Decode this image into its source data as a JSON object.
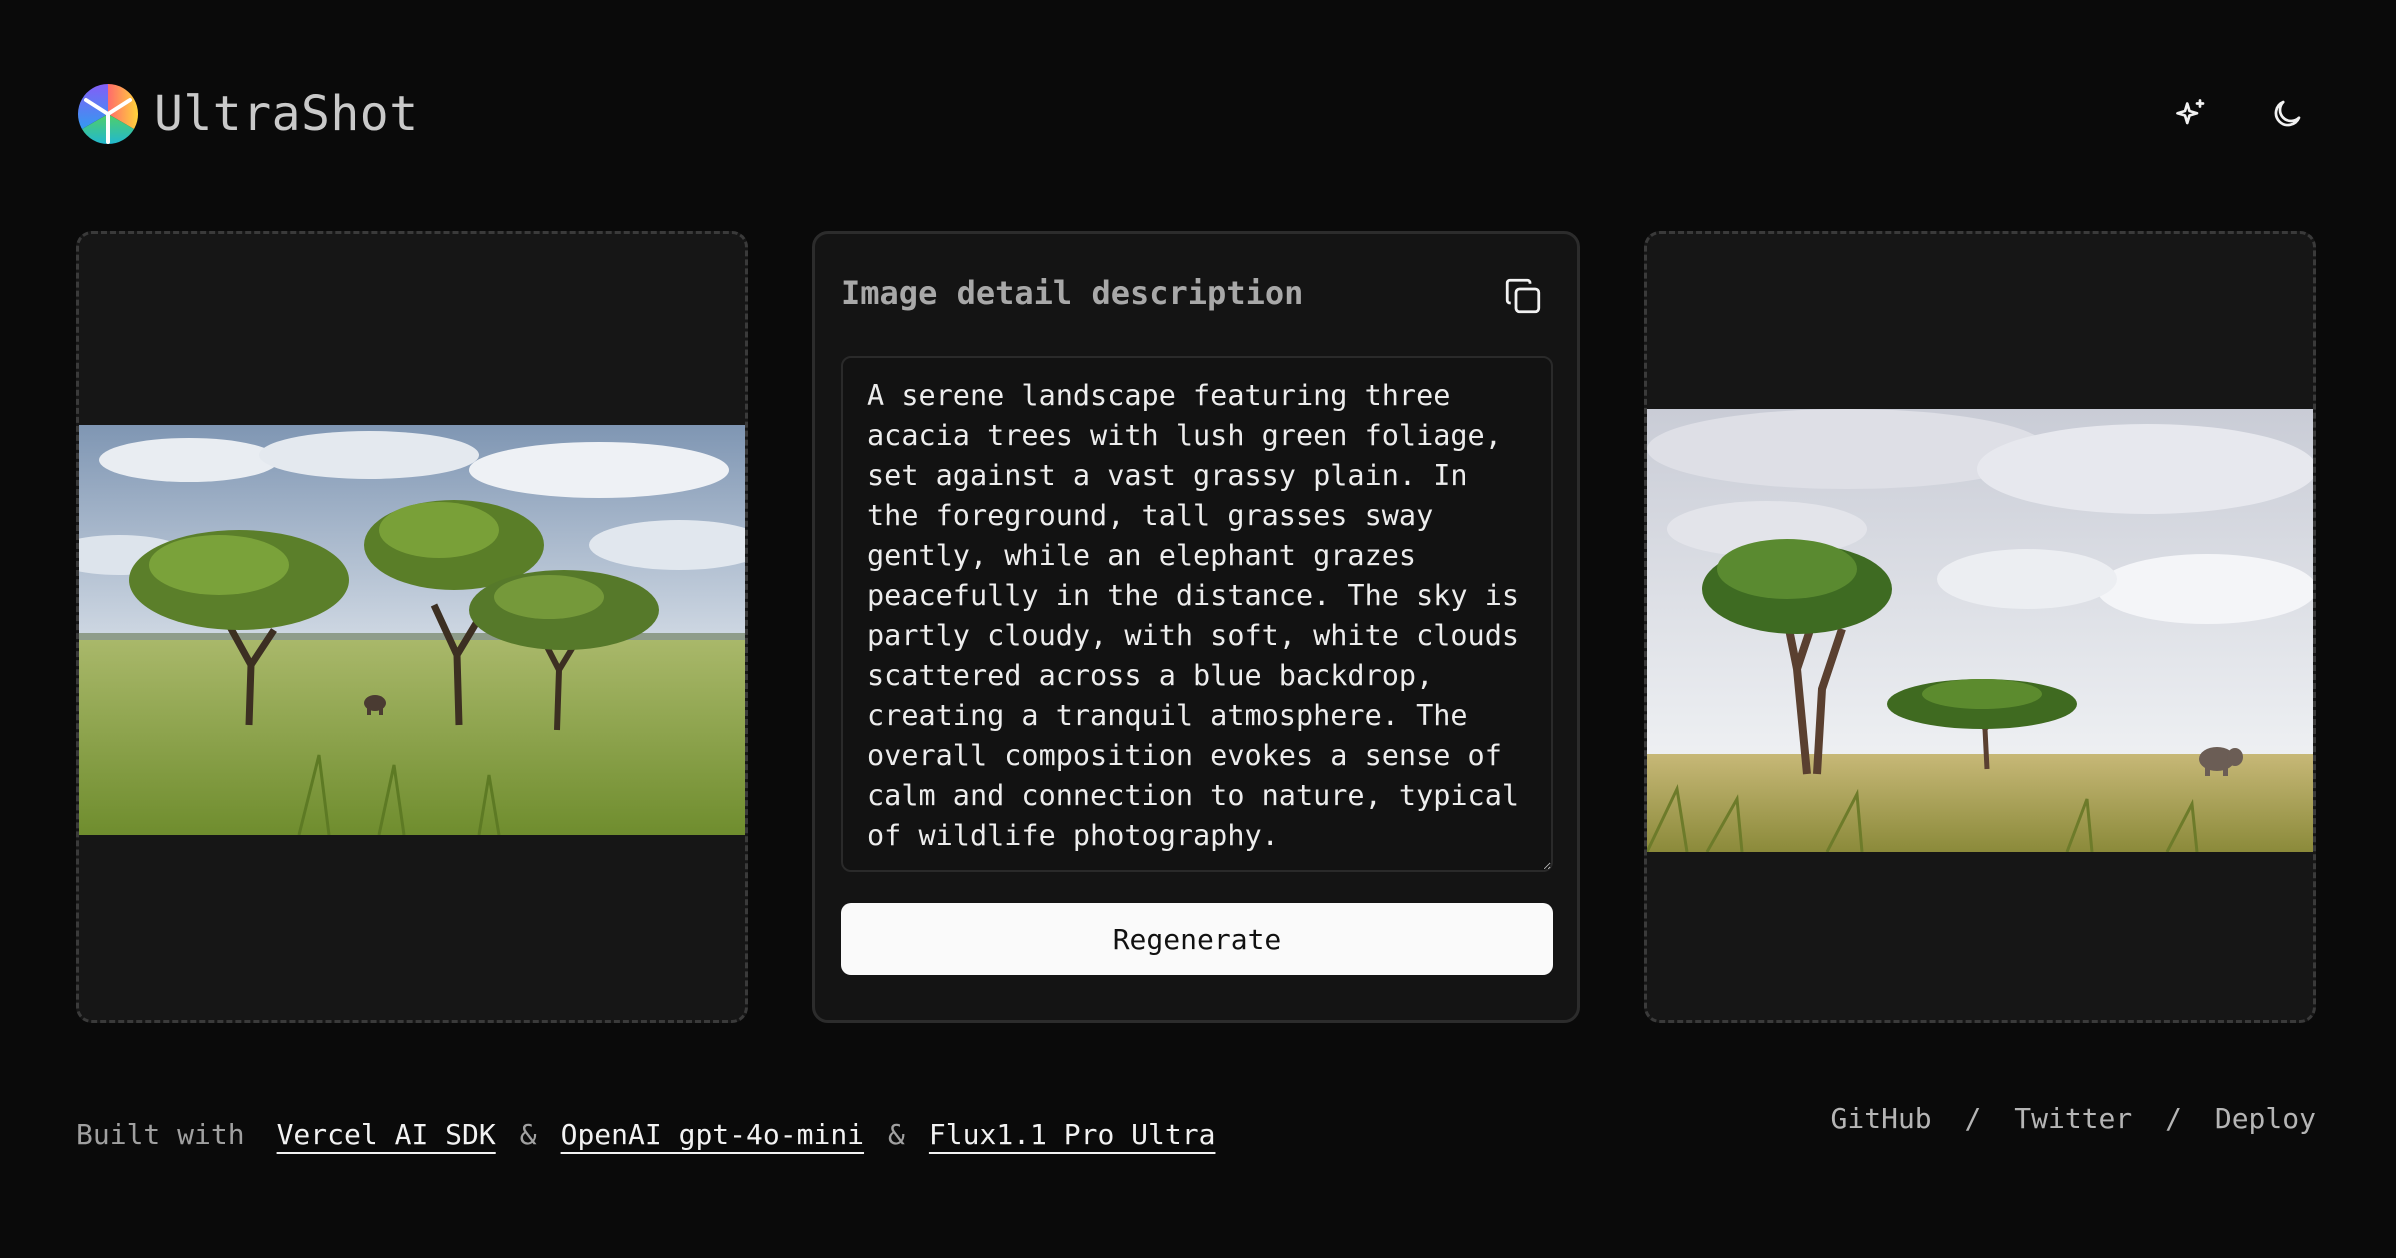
{
  "header": {
    "app_name": "UltraShot",
    "logo_icon": "tricolor-y-logo",
    "actions": [
      {
        "icon": "sparkles-icon"
      },
      {
        "icon": "moon-icon"
      }
    ]
  },
  "description_panel": {
    "title": "Image detail description",
    "copy_icon": "copy-icon",
    "text": "A serene landscape featuring three acacia trees with lush green foliage, set against a vast grassy plain. In the foreground, tall grasses sway gently, while an elephant grazes peacefully in the distance. The sky is partly cloudy, with soft, white clouds scattered across a blue backdrop, creating a tranquil atmosphere. The overall composition evokes a sense of calm and connection to nature, typical of wildlife photography.",
    "button_label": "Regenerate"
  },
  "footer": {
    "built_with": "Built with",
    "separator": "&",
    "links": [
      "Vercel AI SDK",
      "OpenAI gpt-4o-mini",
      "Flux1.1 Pro Ultra"
    ],
    "right_links": [
      "GitHub",
      "Twitter",
      "Deploy"
    ],
    "right_separator": "/"
  },
  "colors": {
    "background": "#0a0a0a",
    "panel": "#161616",
    "button_bg": "#fafafa"
  }
}
